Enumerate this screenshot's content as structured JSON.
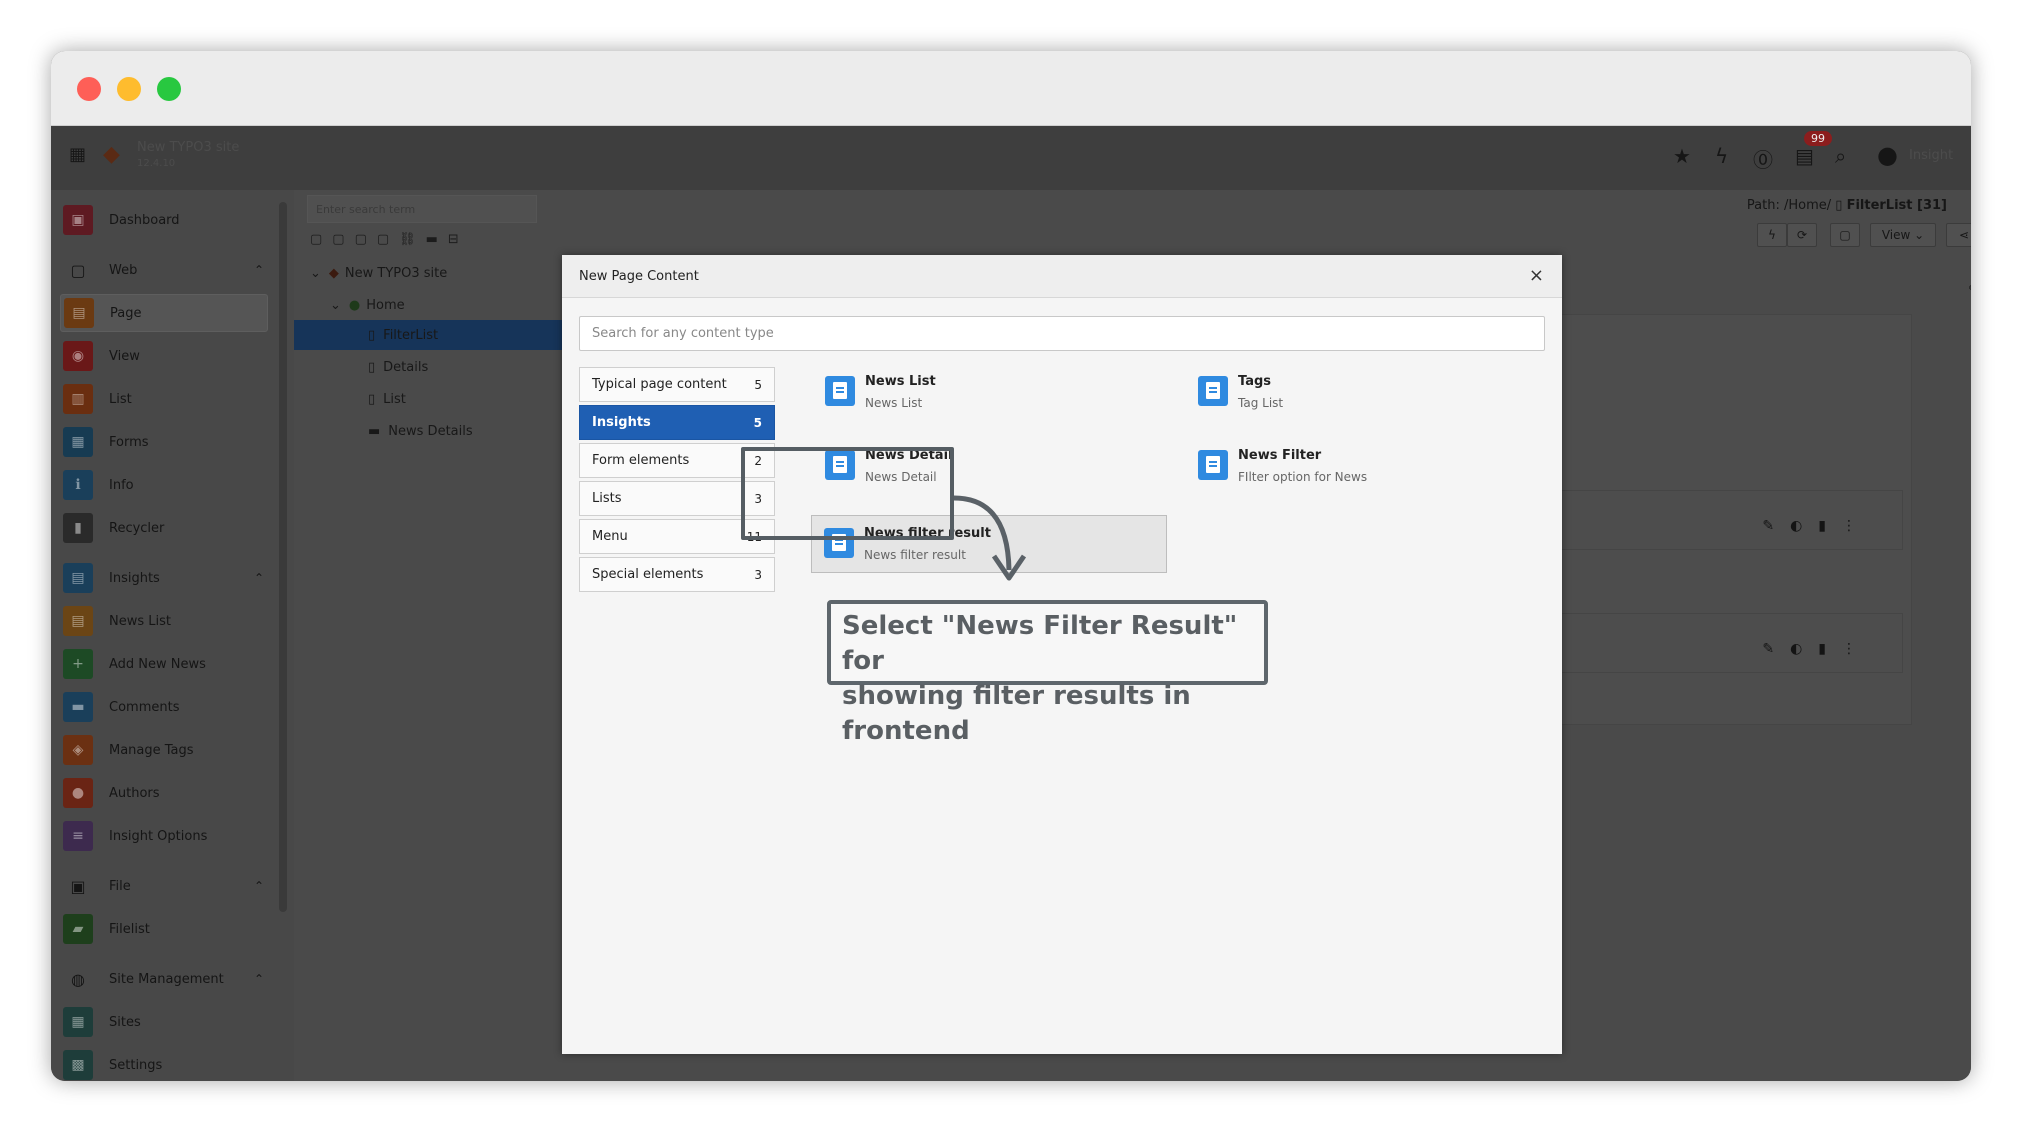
{
  "topbar": {
    "site_name": "New TYPO3 site",
    "site_version": "12.4.10",
    "notification_count": "99",
    "user_name": "Insight"
  },
  "sidebar": {
    "dashboard": "Dashboard",
    "web": "Web",
    "page": "Page",
    "view": "View",
    "list": "List",
    "forms": "Forms",
    "info": "Info",
    "recycler": "Recycler",
    "insights": "Insights",
    "news_list": "News List",
    "add_new_news": "Add New News",
    "comments": "Comments",
    "manage_tags": "Manage Tags",
    "authors": "Authors",
    "insight_options": "Insight Options",
    "file": "File",
    "filelist": "Filelist",
    "site_management": "Site Management",
    "sites": "Sites",
    "settings": "Settings"
  },
  "tree": {
    "search_placeholder": "Enter search term",
    "root": "New TYPO3 site",
    "home": "Home",
    "filterlist": "FilterList",
    "details": "Details",
    "list": "List",
    "news_details": "News Details"
  },
  "content": {
    "path_label": "Path: /Home/",
    "page_title": "FilterList [31]",
    "view_label": "View"
  },
  "modal": {
    "title": "New Page Content",
    "close": "×",
    "search_placeholder": "Search for any content type",
    "categories": [
      {
        "label": "Typical page content",
        "count": "5"
      },
      {
        "label": "Insights",
        "count": "5"
      },
      {
        "label": "Form elements",
        "count": "2"
      },
      {
        "label": "Lists",
        "count": "3"
      },
      {
        "label": "Menu",
        "count": "11"
      },
      {
        "label": "Special elements",
        "count": "3"
      }
    ],
    "items": [
      {
        "title": "News List",
        "desc": "News List"
      },
      {
        "title": "Tags",
        "desc": "Tag List"
      },
      {
        "title": "News Detail",
        "desc": "News Detail"
      },
      {
        "title": "News Filter",
        "desc": "FIlter option for News"
      },
      {
        "title": "News filter result",
        "desc": "News filter result"
      }
    ]
  },
  "callout": {
    "line1": "Select \"News Filter Result\" for",
    "line2": "showing filter results in frontend"
  }
}
